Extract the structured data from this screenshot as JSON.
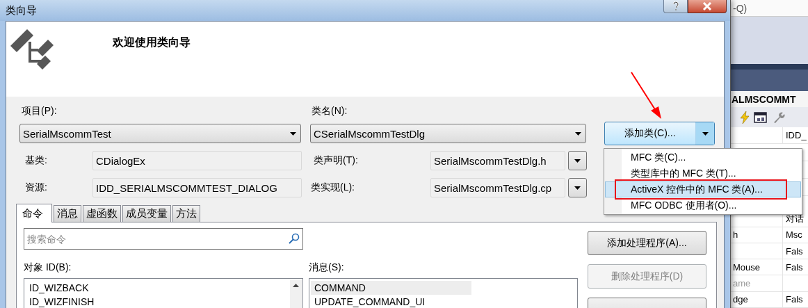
{
  "window": {
    "title": "类向导"
  },
  "header": {
    "heading": "欢迎使用类向导"
  },
  "project": {
    "label": "项目(P):",
    "value": "SerialMscommTest"
  },
  "class_name": {
    "label": "类名(N):",
    "value": "CSerialMscommTestDlg"
  },
  "add_class_button": {
    "label": "添加类(C)...",
    "expanded": true
  },
  "base_class": {
    "label": "基类:",
    "value": "CDialogEx"
  },
  "class_declaration": {
    "label": "类声明(T):",
    "value": "SerialMscommTestDlg.h"
  },
  "resource": {
    "label": "资源:",
    "value": "IDD_SERIALMSCOMMTEST_DIALOG"
  },
  "class_implementation": {
    "label": "类实现(L):",
    "value": "SerialMscommTestDlg.cp"
  },
  "tabs": [
    {
      "label": "命令",
      "selected": true
    },
    {
      "label": "消息",
      "selected": false
    },
    {
      "label": "虚函数",
      "selected": false
    },
    {
      "label": "成员变量",
      "selected": false
    },
    {
      "label": "方法",
      "selected": false
    }
  ],
  "search": {
    "placeholder": "搜索命令"
  },
  "object_ids": {
    "label": "对象 ID(B):",
    "items": [
      {
        "text": "ID_WIZBACK",
        "selected": false
      },
      {
        "text": "ID_WIZFINISH",
        "selected": false
      }
    ]
  },
  "messages": {
    "label": "消息(S):",
    "items": [
      {
        "text": "COMMAND",
        "selected": true
      },
      {
        "text": "UPDATE_COMMAND_UI",
        "selected": false
      }
    ]
  },
  "buttons": [
    {
      "label": "添加处理程序(A)...",
      "disabled": false
    },
    {
      "label": "删除处理程序(D)",
      "disabled": true
    },
    {
      "disabled": false
    }
  ],
  "add_class_menu": [
    {
      "label": "MFC 类(C)...",
      "selected": false,
      "annotated": false
    },
    {
      "label": "类型库中的 MFC 类(T)...",
      "selected": false,
      "annotated": false
    },
    {
      "label": "ActiveX 控件中的 MFC 类(A)...",
      "selected": true,
      "annotated": true
    },
    {
      "label": "MFC ODBC 使用者(O)...",
      "selected": false,
      "annotated": false
    }
  ],
  "background_window": {
    "search_hint": "-Q)",
    "title": "ALMSCOMMT",
    "properties": [
      {
        "value": "IDD_",
        "greyed": false
      },
      {
        "value": "对话",
        "greyed": false
      },
      {
        "name": "h",
        "value": "Msc",
        "greyed": false
      },
      {
        "value": "Fals",
        "greyed": false
      },
      {
        "name": "Mouse",
        "value": "Fals",
        "greyed": false
      },
      {
        "name": "ame",
        "greyed": true
      },
      {
        "name": "dge",
        "value": "Fals",
        "greyed": false
      }
    ]
  }
}
